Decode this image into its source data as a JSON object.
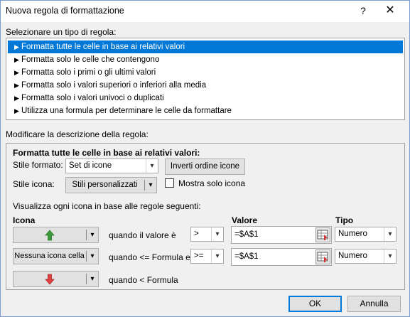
{
  "window": {
    "title": "Nuova regola di formattazione",
    "help_label": "?",
    "close_label": "✕"
  },
  "rule_type": {
    "label": "Selezionare un tipo di regola:",
    "items": [
      {
        "label": "Formatta tutte le celle in base ai relativi valori",
        "selected": true
      },
      {
        "label": "Formatta solo le celle che contengono",
        "selected": false
      },
      {
        "label": "Formatta solo i primi o gli ultimi valori",
        "selected": false
      },
      {
        "label": "Formatta solo i valori superiori o inferiori alla media",
        "selected": false
      },
      {
        "label": "Formatta solo i valori univoci o duplicati",
        "selected": false
      },
      {
        "label": "Utilizza una formula per determinare le celle da formattare",
        "selected": false
      }
    ]
  },
  "description": {
    "label": "Modificare la descrizione della regola:",
    "heading": "Formatta tutte le celle in base ai relativi valori:",
    "style_format_label": "Stile formato:",
    "style_format_value": "Set di icone",
    "reverse_order_button": "Inverti ordine icone",
    "icon_style_label": "Stile icona:",
    "icon_style_value": "Stili personalizzati",
    "show_icon_only_label": "Mostra solo icona",
    "show_icon_only_checked": false,
    "rules_caption": "Visualizza ogni icona in base alle regole seguenti:",
    "columns": {
      "icon": "Icona",
      "value": "Valore",
      "type": "Tipo"
    },
    "rows": [
      {
        "icon": "green-up-arrow",
        "icon_label": "",
        "condition": "quando il valore è",
        "operator": ">",
        "value": "=$A$1",
        "type": "Numero"
      },
      {
        "icon": "none",
        "icon_label": "Nessuna icona cella",
        "condition": "quando <= Formula e",
        "operator": ">=",
        "value": "=$A$1",
        "type": "Numero"
      },
      {
        "icon": "red-down-arrow",
        "icon_label": "",
        "condition": "quando < Formula"
      }
    ]
  },
  "buttons": {
    "ok": "OK",
    "cancel": "Annulla"
  },
  "colors": {
    "selection": "#0078d7",
    "up_arrow": "#3a9a3a",
    "down_arrow": "#e04040"
  }
}
